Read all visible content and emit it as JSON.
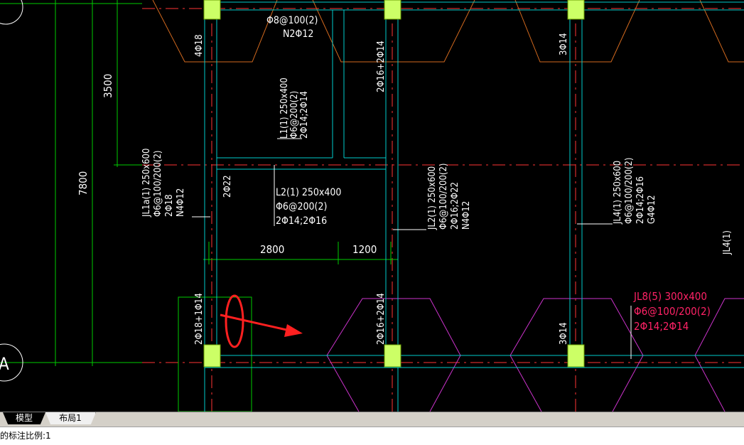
{
  "drawing": {
    "dims": {
      "d7800": "7800",
      "d3500": "3500",
      "d2800": "2800",
      "d1200": "1200"
    },
    "axes": {
      "a": "A"
    },
    "top_beam": {
      "line1": "Φ8@100(2)",
      "line2": "N2Φ12"
    },
    "column_bars": {
      "c1": "4Φ18",
      "c2": "2Φ16+2Φ14",
      "c3": "3Φ14",
      "c4": "2Φ22",
      "c5": "2Φ18+1Φ14",
      "c6": "2Φ16+2Φ14",
      "c7": "3Φ14"
    },
    "L1": {
      "line1": "L1(1) 250x400",
      "line2": "Φ6@200(2)",
      "line3": "2Φ14;2Φ14"
    },
    "L2": {
      "line1": "L2(1) 250x400",
      "line2": "Φ6@200(2)",
      "line3": "2Φ14;2Φ16"
    },
    "JL1a": {
      "line1": "JL1a(1) 250x600",
      "line2": "Φ6@100/200(2)",
      "line3": "2Φ18",
      "line4": "N4Φ12"
    },
    "JL2": {
      "line1": "JL2(1) 250x600",
      "line2": "Φ6@100/200(2)",
      "line3": "2Φ16;2Φ22",
      "line4": "N4Φ12"
    },
    "JL4": {
      "line1": "JL4(1) 250x600",
      "line2": "Φ6@100/200(2)",
      "line3": "2Φ14;2Φ16",
      "line4": "G4Φ12",
      "edge_label": "JL4(1)"
    },
    "JL8": {
      "line1": "JL8(5) 300x400",
      "line2": "Φ6@100/200(2)",
      "line3": "2Φ14;2Φ14"
    },
    "colors": {
      "background": "#000000",
      "column_fill": "#ccff66",
      "beam_cyan": "#00cccc",
      "dimension_green": "#00cc00",
      "axis_red": "#ff3333",
      "footing_orange": "#d2691e",
      "footing_magenta": "#cc33cc",
      "jl8_text": "#ff2266",
      "markup_red": "#ff2020"
    }
  },
  "tabs": {
    "model": "模型",
    "layout1": "布局1"
  },
  "status": {
    "text": "的标注比例:1"
  }
}
